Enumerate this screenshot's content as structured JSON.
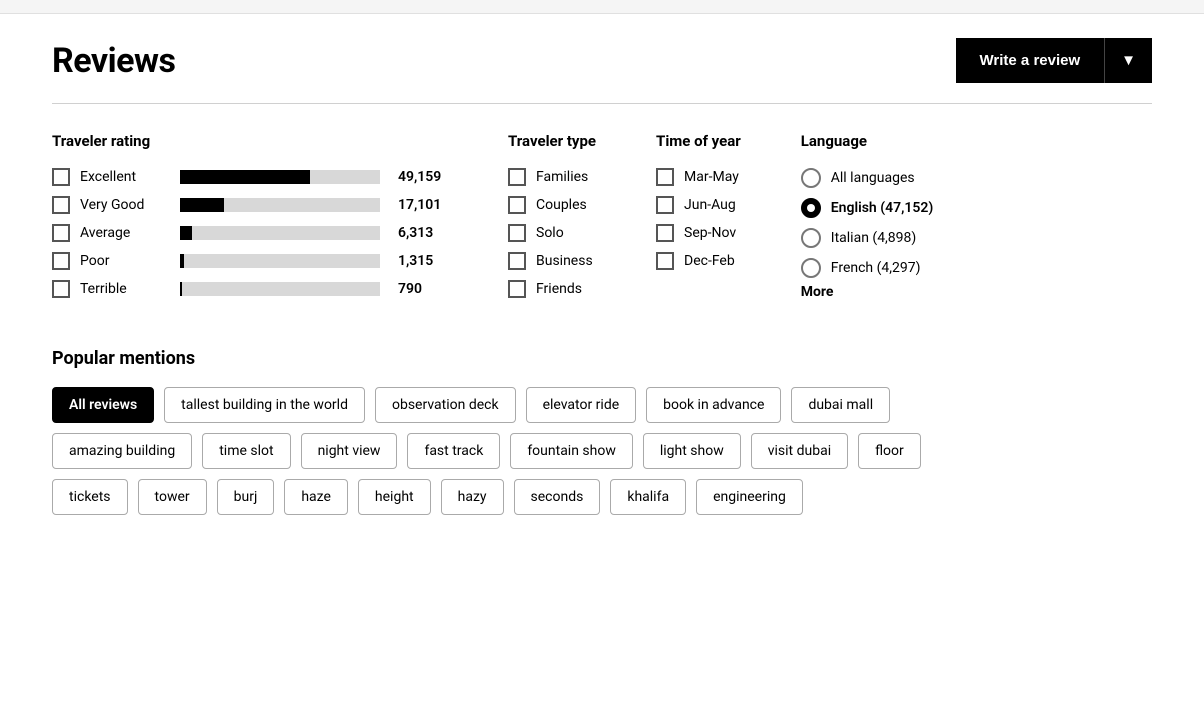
{
  "header": {
    "title": "Reviews",
    "write_review_label": "Write a review",
    "dropdown_arrow": "▼"
  },
  "traveler_rating": {
    "title": "Traveler rating",
    "items": [
      {
        "label": "Excellent",
        "count": "49,159",
        "bar_pct": 65
      },
      {
        "label": "Very Good",
        "count": "17,101",
        "bar_pct": 22
      },
      {
        "label": "Average",
        "count": "6,313",
        "bar_pct": 6
      },
      {
        "label": "Poor",
        "count": "1,315",
        "bar_pct": 2
      },
      {
        "label": "Terrible",
        "count": "790",
        "bar_pct": 1
      }
    ]
  },
  "traveler_type": {
    "title": "Traveler type",
    "items": [
      "Families",
      "Couples",
      "Solo",
      "Business",
      "Friends"
    ]
  },
  "time_of_year": {
    "title": "Time of year",
    "items": [
      "Mar-May",
      "Jun-Aug",
      "Sep-Nov",
      "Dec-Feb"
    ]
  },
  "language": {
    "title": "Language",
    "items": [
      {
        "label": "All languages",
        "selected": false
      },
      {
        "label": "English (47,152)",
        "selected": true
      },
      {
        "label": "Italian (4,898)",
        "selected": false
      },
      {
        "label": "French (4,297)",
        "selected": false
      }
    ],
    "more_label": "More"
  },
  "popular_mentions": {
    "title": "Popular mentions",
    "rows": [
      [
        "All reviews",
        "tallest building in the world",
        "observation deck",
        "elevator ride",
        "book in advance",
        "dubai mall"
      ],
      [
        "amazing building",
        "time slot",
        "night view",
        "fast track",
        "fountain show",
        "light show",
        "visit dubai",
        "floor"
      ],
      [
        "tickets",
        "tower",
        "burj",
        "haze",
        "height",
        "hazy",
        "seconds",
        "khalifa",
        "engineering"
      ]
    ],
    "active_tag": "All reviews"
  }
}
